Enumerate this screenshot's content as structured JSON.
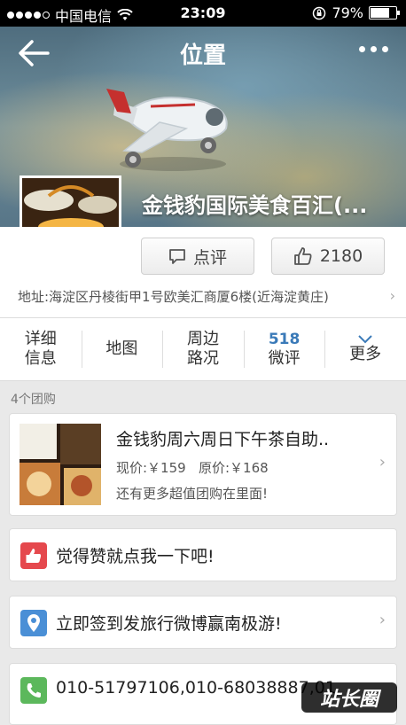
{
  "status_bar": {
    "carrier": "中国电信",
    "time": "23:09",
    "battery": "79%",
    "battery_level": 0.79
  },
  "nav": {
    "title": "位置"
  },
  "shop": {
    "name": "金钱豹国际美食百汇(...",
    "review_label": "点评",
    "like_count": "2180",
    "address": "地址:海淀区丹棱街甲1号欧美汇商厦6楼(近海淀黄庄)"
  },
  "tabs": [
    {
      "line1": "详细",
      "line2": "信息"
    },
    {
      "line1": "地图",
      "line2": ""
    },
    {
      "line1": "周边",
      "line2": "路况"
    },
    {
      "line1": "518",
      "line2": "微评"
    },
    {
      "line1": "",
      "line2": "更多"
    }
  ],
  "deals": {
    "count_label": "4个团购",
    "title": "金钱豹周六周日下午茶自助..",
    "price_line": "现价:￥159   原价:￥168",
    "more": "还有更多超值团购在里面!"
  },
  "rows": {
    "like": "觉得赞就点我一下吧!",
    "checkin": "立即签到发旅行微博赢南极游!",
    "phone": "010-51797106,010-68038887,01"
  },
  "watermark": "站长圈",
  "colors": {
    "accent_blue": "#3a7ab8",
    "like_red": "#e5484d",
    "location_blue": "#4a8fd6",
    "phone_green": "#5cb85c"
  }
}
